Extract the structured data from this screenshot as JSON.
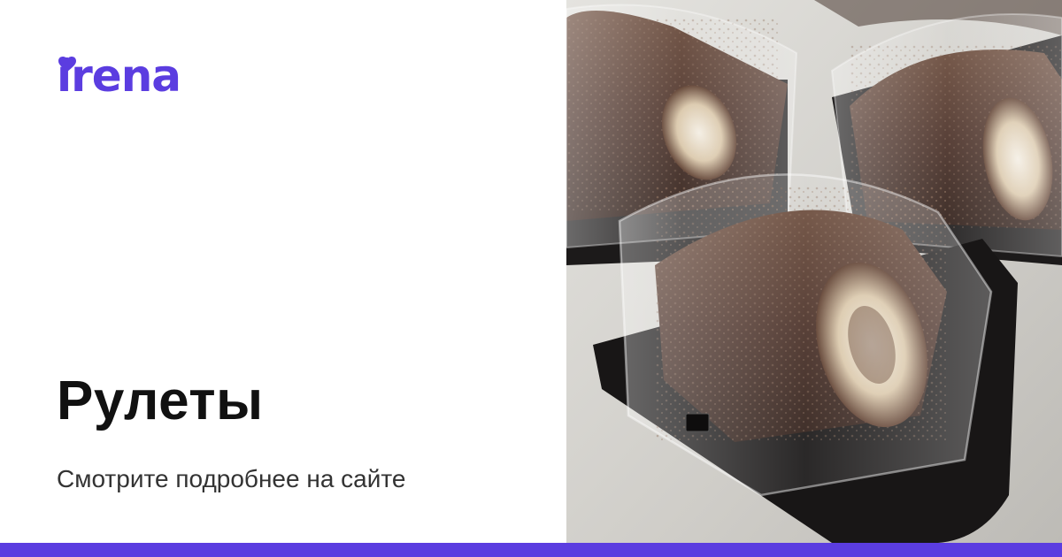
{
  "brand": {
    "logo_text": "irena",
    "color": "#5b3de0"
  },
  "card": {
    "title": "Рулеты",
    "subtitle": "Смотрите подробнее на сайте"
  },
  "photo": {
    "subject": "chocolate-roll-cakes-in-plastic-containers"
  },
  "icons": [
    "heart-icon"
  ]
}
